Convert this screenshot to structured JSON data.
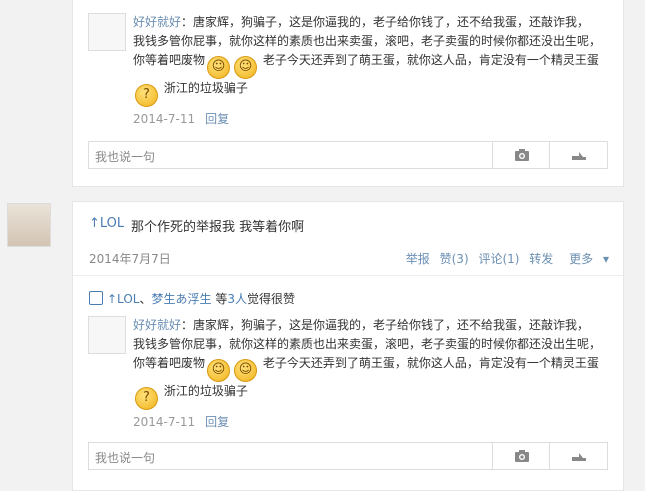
{
  "reply": {
    "username": "好好就好",
    "text_line1": "：唐家辉，狗骗子，这是你逼我的，老子给你钱了，还不给我蛋，还敲诈我，",
    "text_line2": "我钱多管你屁事，就你这样的素质也出来卖蛋，滚吧，老子卖蛋的时候你都还没出生呢，",
    "text_line3a": "你等着吧废物",
    "text_line3b": "老子今天还弄到了萌王蛋，就你这人品，肯定没有一个精灵王蛋",
    "text_line4": "浙江的垃圾骗子",
    "date": "2014-7-11",
    "reply_label": "回复"
  },
  "comment_box": {
    "placeholder": "我也说一句"
  },
  "post": {
    "user": "↑LOL",
    "text": "那个作死的举报我  我等着你啊",
    "date": "2014年7月7日",
    "actions": {
      "report": "举报",
      "like": "赞(3)",
      "comment": "评论(1)",
      "share": "转发",
      "more": "更多"
    }
  },
  "likes": {
    "user1": "↑LOL",
    "sep": "、",
    "user2": "梦生あ浮生",
    "prefix": "等",
    "count": "3人",
    "suffix": "觉得很赞"
  },
  "icons": {
    "emoji": "smiley-emoji",
    "camera": "camera-icon",
    "share": "share-icon",
    "thumb": "thumb-up-icon"
  }
}
